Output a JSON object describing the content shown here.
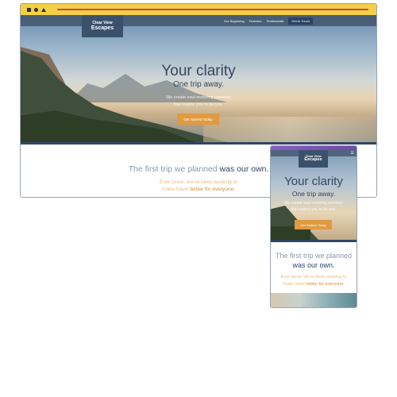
{
  "brand": {
    "line1": "Clear View",
    "line2": "Escapes"
  },
  "nav": {
    "items": [
      "Our Beginning",
      "Features",
      "Testimonials"
    ],
    "cta": "Get In Touch"
  },
  "hero": {
    "title": "Your clarity",
    "subtitle": "One trip away.",
    "body_line1": "We create soul restoring journeys",
    "body_line2": "that inspire you to be you.",
    "button": "Get Started Today"
  },
  "section": {
    "title_light": "The first trip we planned",
    "title_bold": "was our own.",
    "text_line1": "Ever since, we've been working to",
    "text_line2_prefix": "make travel",
    "text_line2_highlight": "better for everyone."
  },
  "mobile": {
    "menu_icon": "☰"
  },
  "colors": {
    "accent": "#e09a42",
    "navy": "#2f4566",
    "chrome_yellow": "#f2cf46",
    "chrome_red": "#e0403e"
  },
  "icons": {
    "window_controls": [
      "square-icon",
      "circle-icon",
      "triangle-icon"
    ],
    "mobile_menu": "hamburger-menu-icon"
  }
}
